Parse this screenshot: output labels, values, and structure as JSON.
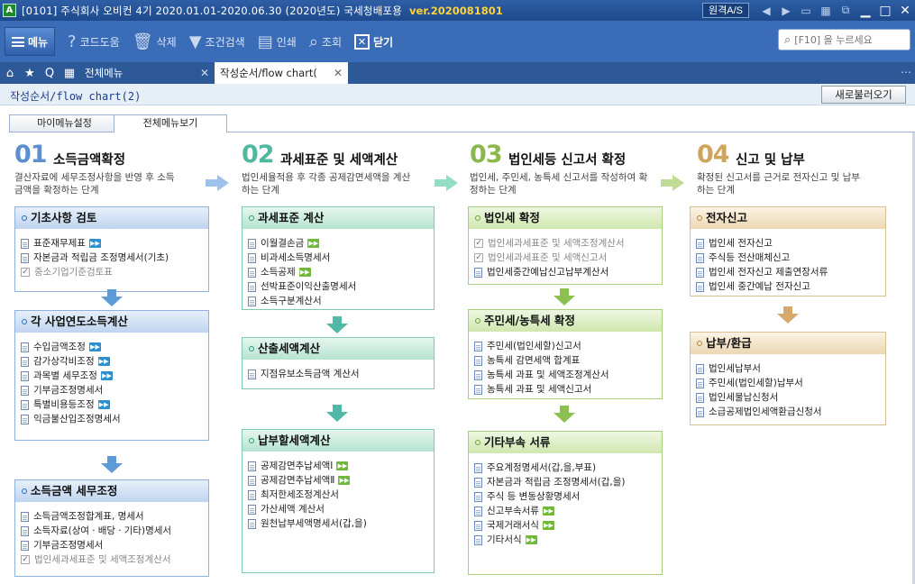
{
  "window": {
    "app_icon_letter": "A",
    "title": "[0101] 주식회사 오비컨   4기  2020.01.01-2020.06.30  (2020년도)   국세청배포용",
    "version": "ver.2020081801",
    "remote_label": "원격A/S"
  },
  "toolbar": {
    "menu_label": "메뉴",
    "code_help": "코드도움",
    "delete": "삭제",
    "condition_search": "조건검색",
    "print": "인쇄",
    "inquiry": "조회",
    "close": "닫기",
    "search_placeholder": "[F10] 을 누르세요"
  },
  "tabs": {
    "all_menu": "전체메뉴",
    "active": "작성순서/flow chart(",
    "close_glyph": "✕"
  },
  "page": {
    "title": "작성순서/flow chart(2)",
    "refresh_label": "새로불러오기"
  },
  "subtabs": {
    "my_menu": "마이메뉴설정",
    "all_menu_view": "전체메뉴보기"
  },
  "steps": [
    {
      "num": "01",
      "title": "소득금액확정",
      "desc": "결산자료에 세무조정사항을 반영 후 소득금액을 확정하는 단계",
      "boxes": [
        {
          "title": "기초사항 검토",
          "items": [
            {
              "text": "표준재무제표",
              "mark": "doc",
              "go": "blue"
            },
            {
              "text": "자본금과 적립금 조정명세서(기초)",
              "mark": "doc",
              "go": ""
            },
            {
              "text": "중소기업기준검토표",
              "mark": "chk",
              "go": ""
            }
          ]
        },
        {
          "title": "각 사업연도소득계산",
          "items": [
            {
              "text": "수입금액조정",
              "mark": "doc",
              "go": "blue"
            },
            {
              "text": "감가상각비조정",
              "mark": "doc",
              "go": "blue"
            },
            {
              "text": "과목별 세무조정",
              "mark": "doc",
              "go": "blue"
            },
            {
              "text": "기부금조정명세서",
              "mark": "doc",
              "go": ""
            },
            {
              "text": "특별비용등조정",
              "mark": "doc",
              "go": "blue"
            },
            {
              "text": "익금불산입조정명세서",
              "mark": "doc",
              "go": ""
            }
          ]
        },
        {
          "title": "소득금액 세무조정",
          "items": [
            {
              "text": "소득금액조정합계표, 명세서",
              "mark": "doc",
              "go": ""
            },
            {
              "text": "소득자료(상여ㆍ배당ㆍ기타)명세서",
              "mark": "doc",
              "go": ""
            },
            {
              "text": "기부금조정명세서",
              "mark": "doc",
              "go": ""
            },
            {
              "text": "법인세과세표준 및 세액조정계산서",
              "mark": "chk",
              "go": ""
            }
          ]
        }
      ]
    },
    {
      "num": "02",
      "title": "과세표준 및 세액계산",
      "desc": "법인세율적용 후 각종 공제감면세액을 계산하는 단계",
      "boxes": [
        {
          "title": "과세표준 계산",
          "items": [
            {
              "text": "이월결손금",
              "mark": "doc",
              "go": "green"
            },
            {
              "text": "비과세소득명세서",
              "mark": "doc",
              "go": ""
            },
            {
              "text": "소득공제",
              "mark": "doc",
              "go": "green"
            },
            {
              "text": "선박표준이익산출명세서",
              "mark": "doc",
              "go": ""
            },
            {
              "text": "소득구분계산서",
              "mark": "doc",
              "go": ""
            }
          ]
        },
        {
          "title": "산출세액계산",
          "items": [
            {
              "text": "지점유보소득금액 계산서",
              "mark": "doc",
              "go": ""
            }
          ]
        },
        {
          "title": "납부할세액계산",
          "items": [
            {
              "text": "공제감면추납세액Ⅰ",
              "mark": "doc",
              "go": "green"
            },
            {
              "text": "공제감면추납세액Ⅱ",
              "mark": "doc",
              "go": "green"
            },
            {
              "text": "최저한세조정계산서",
              "mark": "doc",
              "go": ""
            },
            {
              "text": "가산세액 계산서",
              "mark": "doc",
              "go": ""
            },
            {
              "text": "원천납부세액명세서(갑,을)",
              "mark": "doc",
              "go": ""
            }
          ]
        }
      ]
    },
    {
      "num": "03",
      "title": "법인세등 신고서 확정",
      "desc": "법인세, 주민세, 농특세 신고서를 작성하여 확정하는 단계",
      "boxes": [
        {
          "title": "법인세 확정",
          "items": [
            {
              "text": "법인세과세표준 및 세액조정계산서",
              "mark": "chk",
              "go": ""
            },
            {
              "text": "법인세과세표준 및 세액신고서",
              "mark": "chk",
              "go": ""
            },
            {
              "text": "법인세중간예납신고납부계산서",
              "mark": "doc",
              "go": ""
            }
          ]
        },
        {
          "title": "주민세/농특세 확정",
          "items": [
            {
              "text": "주민세(법인세할)신고서",
              "mark": "doc",
              "go": ""
            },
            {
              "text": "농특세 감면세액 합계표",
              "mark": "doc",
              "go": ""
            },
            {
              "text": "농특세 과표 및 세액조정계산서",
              "mark": "doc",
              "go": ""
            },
            {
              "text": "농특세 과표 및 세액신고서",
              "mark": "doc",
              "go": ""
            }
          ]
        },
        {
          "title": "기타부속 서류",
          "items": [
            {
              "text": "주요계정명세서(갑,을,부표)",
              "mark": "doc",
              "go": ""
            },
            {
              "text": "자본금과 적립금 조정명세서(갑,을)",
              "mark": "doc",
              "go": ""
            },
            {
              "text": "주식 등 변동상황명세서",
              "mark": "doc",
              "go": ""
            },
            {
              "text": "신고부속서류",
              "mark": "doc",
              "go": "green"
            },
            {
              "text": "국제거래서식",
              "mark": "doc",
              "go": "green"
            },
            {
              "text": "기타서식",
              "mark": "doc",
              "go": "green"
            }
          ]
        }
      ]
    },
    {
      "num": "04",
      "title": "신고 및 납부",
      "desc": "확정된 신고서를 근거로 전자신고 및 납부하는 단계",
      "boxes": [
        {
          "title": "전자신고",
          "items": [
            {
              "text": "법인세 전자신고",
              "mark": "doc",
              "go": ""
            },
            {
              "text": "주식등 전산매체신고",
              "mark": "doc",
              "go": ""
            },
            {
              "text": "법인세 전자신고 제출연장서류",
              "mark": "doc",
              "go": ""
            },
            {
              "text": "법인세 중간예납 전자신고",
              "mark": "doc",
              "go": ""
            }
          ]
        },
        {
          "title": "납부/환급",
          "items": [
            {
              "text": "법인세납부서",
              "mark": "doc",
              "go": ""
            },
            {
              "text": "주민세(법인세할)납부서",
              "mark": "doc",
              "go": ""
            },
            {
              "text": "법인세물납신청서",
              "mark": "doc",
              "go": ""
            },
            {
              "text": "소급공제법인세액환급신청서",
              "mark": "doc",
              "go": ""
            }
          ]
        }
      ]
    }
  ],
  "colors": {
    "title_bar": "#2e5ea5",
    "toolbar": "#3a6cb8",
    "step1": "#5d8fd0",
    "step2": "#4fb89e",
    "step3": "#8ab84e",
    "step4": "#cfa45c",
    "version": "#ffd23a"
  },
  "icons": {
    "home": "home-icon",
    "star": "star-icon",
    "search": "search-icon",
    "grid": "grid-icon"
  }
}
